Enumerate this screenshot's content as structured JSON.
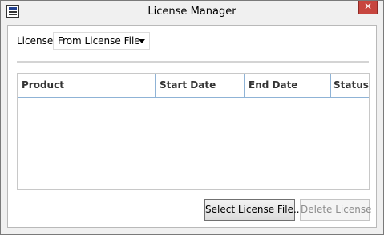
{
  "window": {
    "title": "License Manager",
    "close_glyph": "✕"
  },
  "license": {
    "label": "License:",
    "selected_value": "From License File"
  },
  "table": {
    "columns": [
      "Product",
      "Start Date",
      "End Date",
      "Status"
    ],
    "rows": []
  },
  "buttons": {
    "select_license_file": "Select License File...",
    "delete_license": "Delete License"
  },
  "colors": {
    "close_button": "#c7463f",
    "header_divider": "#8fb3d6",
    "disabled_text": "#8d8d8d"
  }
}
